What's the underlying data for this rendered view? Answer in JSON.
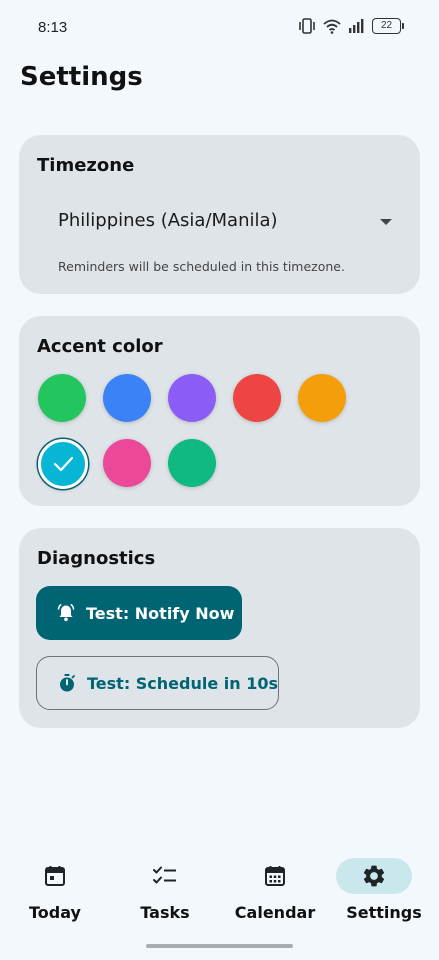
{
  "status_bar": {
    "time": "8:13",
    "battery": "22",
    "icons": [
      "vibrate-icon",
      "wifi-icon",
      "signal-icon",
      "battery-icon"
    ]
  },
  "page": {
    "title": "Settings"
  },
  "timezone": {
    "title": "Timezone",
    "selected": "Philippines (Asia/Manila)",
    "helper": "Reminders will be scheduled in this timezone."
  },
  "accent": {
    "title": "Accent color",
    "colors": [
      "#22c55e",
      "#3b82f6",
      "#8b5cf6",
      "#ef4444",
      "#f59e0b",
      "#06b6d4",
      "#ec4899",
      "#10b981"
    ],
    "selected_color": "#06b6d4"
  },
  "diagnostics": {
    "title": "Diagnostics",
    "notify_now_label": "Test: Notify Now",
    "schedule_label": "Test: Schedule in 10s"
  },
  "nav": {
    "items": [
      {
        "label": "Today",
        "icon": "calendar-day-icon"
      },
      {
        "label": "Tasks",
        "icon": "checklist-icon"
      },
      {
        "label": "Calendar",
        "icon": "calendar-icon"
      },
      {
        "label": "Settings",
        "icon": "gear-icon"
      }
    ],
    "active": "Settings"
  },
  "theme": {
    "primary": "#016473",
    "card_bg": "#dfe4e8",
    "page_bg": "#f2f8fb",
    "nav_active_bg": "#cbe7ee"
  }
}
